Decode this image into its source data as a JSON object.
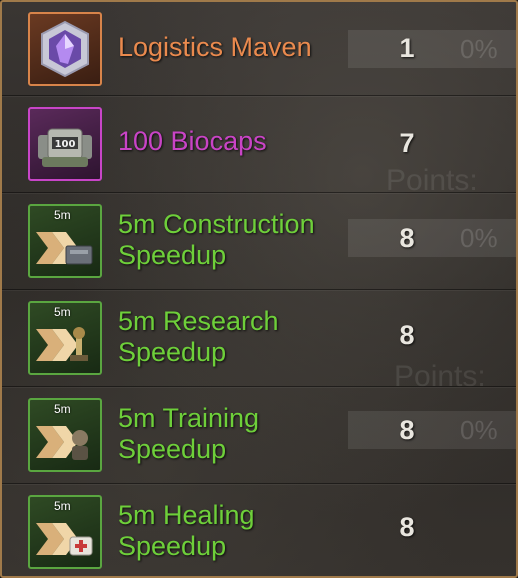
{
  "items": [
    {
      "name": "Logistics Maven",
      "count": "1",
      "name_color": "#ea8a4e",
      "rarity": "orange",
      "icon": "purple-crystal-icon",
      "tag": ""
    },
    {
      "name": "100 Biocaps",
      "count": "7",
      "name_color": "#c944c6",
      "rarity": "purple",
      "icon": "biocaps-stack-icon",
      "tag": "100"
    },
    {
      "name_line1": "5m Construction",
      "name_line2": "Speedup",
      "count": "8",
      "name_color": "#6ecf3a",
      "rarity": "green",
      "icon": "construction-speedup-icon",
      "tag": "5m"
    },
    {
      "name_line1": "5m Research",
      "name_line2": "Speedup",
      "count": "8",
      "name_color": "#6ecf3a",
      "rarity": "green",
      "icon": "research-speedup-icon",
      "tag": "5m"
    },
    {
      "name_line1": "5m Training",
      "name_line2": "Speedup",
      "count": "8",
      "name_color": "#6ecf3a",
      "rarity": "green",
      "icon": "training-speedup-icon",
      "tag": "5m"
    },
    {
      "name_line1": "5m Healing",
      "name_line2": "Speedup",
      "count": "8",
      "name_color": "#6ecf3a",
      "rarity": "green",
      "icon": "healing-speedup-icon",
      "tag": "5m"
    }
  ],
  "background": {
    "ghost_percent": "0%",
    "ghost_points": "Points:"
  }
}
